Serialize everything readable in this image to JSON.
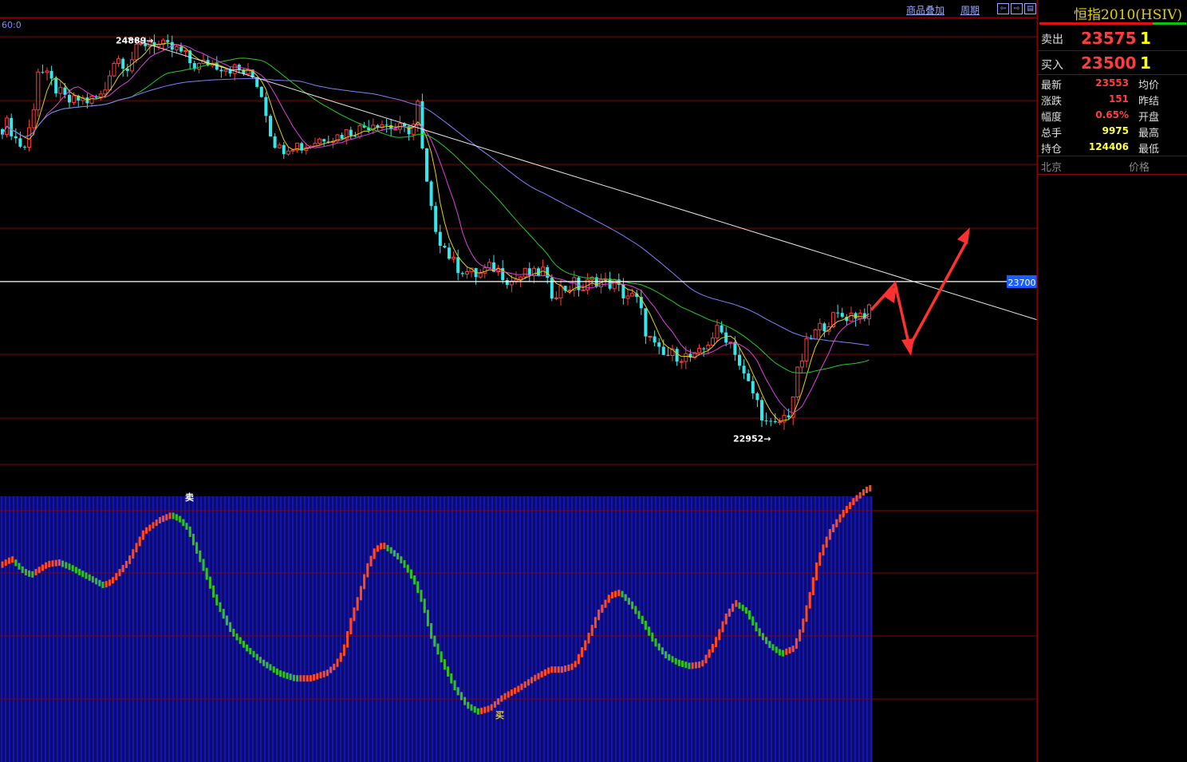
{
  "toolbar": {
    "overlay_label": "商品叠加",
    "period_label": "周期",
    "nav_left": "⇦",
    "nav_right": "⇨",
    "nav_menu": "▤",
    "period_indicator": "60:0"
  },
  "quote_panel": {
    "title": "恒指2010(HSIV)",
    "sell_label": "卖出",
    "sell_price": "23575",
    "sell_qty": "1",
    "buy_label": "买入",
    "buy_price": "23500",
    "buy_qty": "1",
    "rows": [
      {
        "label": "最新",
        "value": "23553",
        "label2": "均价",
        "color": "#ff4040"
      },
      {
        "label": "涨跌",
        "value": "151",
        "label2": "昨结",
        "color": "#ff4040"
      },
      {
        "label": "幅度",
        "value": "0.65%",
        "label2": "开盘",
        "color": "#ff4040"
      },
      {
        "label": "总手",
        "value": "9975",
        "label2": "最高",
        "color": "#ffff40"
      },
      {
        "label": "持仓",
        "value": "124406",
        "label2": "最低",
        "color": "#ffff40"
      }
    ],
    "footer_left": "北京",
    "footer_right": "价格"
  },
  "colors": {
    "up_candle": "#ff3c3c",
    "down_candle": "#33e8ea",
    "ma1": "#e6d200",
    "ma2": "#e040e0",
    "ma3": "#20d020",
    "ma4": "#8080ff",
    "grid": "#8b0000",
    "osc_bg": "#1a1ac8",
    "osc_up": "#ff4a20",
    "osc_down": "#30c020"
  },
  "chart_data": {
    "type": "candlestick",
    "ylim": [
      22800,
      25000
    ],
    "price_line": 23700,
    "price_line_label": "23700",
    "high_label": "24889",
    "low_label": "22952",
    "close_path": [
      [
        0,
        24450
      ],
      [
        10,
        24480
      ],
      [
        20,
        24400
      ],
      [
        30,
        24350
      ],
      [
        40,
        24500
      ],
      [
        48,
        24750
      ],
      [
        60,
        24700
      ],
      [
        70,
        24650
      ],
      [
        80,
        24600
      ],
      [
        90,
        24580
      ],
      [
        100,
        24600
      ],
      [
        110,
        24590
      ],
      [
        120,
        24600
      ],
      [
        130,
        24620
      ],
      [
        140,
        24780
      ],
      [
        150,
        24800
      ],
      [
        160,
        24760
      ],
      [
        170,
        24830
      ],
      [
        180,
        24870
      ],
      [
        190,
        24889
      ],
      [
        200,
        24860
      ],
      [
        210,
        24850
      ],
      [
        220,
        24840
      ],
      [
        230,
        24820
      ],
      [
        240,
        24770
      ],
      [
        250,
        24760
      ],
      [
        260,
        24780
      ],
      [
        270,
        24770
      ],
      [
        280,
        24760
      ],
      [
        290,
        24750
      ],
      [
        300,
        24740
      ],
      [
        310,
        24720
      ],
      [
        320,
        24700
      ],
      [
        330,
        24600
      ],
      [
        340,
        24420
      ],
      [
        350,
        24350
      ],
      [
        360,
        24370
      ],
      [
        370,
        24380
      ],
      [
        380,
        24360
      ],
      [
        390,
        24380
      ],
      [
        400,
        24400
      ],
      [
        410,
        24420
      ],
      [
        420,
        24410
      ],
      [
        430,
        24430
      ],
      [
        440,
        24440
      ],
      [
        450,
        24450
      ],
      [
        460,
        24470
      ],
      [
        470,
        24490
      ],
      [
        480,
        24480
      ],
      [
        490,
        24460
      ],
      [
        500,
        24450
      ],
      [
        510,
        24440
      ],
      [
        520,
        24480
      ],
      [
        525,
        24600
      ],
      [
        530,
        24300
      ],
      [
        540,
        24050
      ],
      [
        550,
        23920
      ],
      [
        560,
        23850
      ],
      [
        570,
        23780
      ],
      [
        580,
        23760
      ],
      [
        590,
        23740
      ],
      [
        600,
        23730
      ],
      [
        610,
        23760
      ],
      [
        620,
        23770
      ],
      [
        630,
        23740
      ],
      [
        640,
        23700
      ],
      [
        650,
        23720
      ],
      [
        660,
        23740
      ],
      [
        670,
        23730
      ],
      [
        680,
        23760
      ],
      [
        690,
        23640
      ],
      [
        700,
        23660
      ],
      [
        710,
        23670
      ],
      [
        720,
        23690
      ],
      [
        730,
        23660
      ],
      [
        740,
        23700
      ],
      [
        750,
        23710
      ],
      [
        760,
        23690
      ],
      [
        770,
        23690
      ],
      [
        780,
        23640
      ],
      [
        790,
        23630
      ],
      [
        800,
        23600
      ],
      [
        810,
        23450
      ],
      [
        820,
        23380
      ],
      [
        830,
        23330
      ],
      [
        840,
        23340
      ],
      [
        850,
        23340
      ],
      [
        860,
        23330
      ],
      [
        870,
        23320
      ],
      [
        880,
        23350
      ],
      [
        890,
        23420
      ],
      [
        900,
        23460
      ],
      [
        910,
        23430
      ],
      [
        920,
        23380
      ],
      [
        930,
        23250
      ],
      [
        940,
        23180
      ],
      [
        950,
        23100
      ],
      [
        960,
        23000
      ],
      [
        970,
        22980
      ],
      [
        980,
        23020
      ],
      [
        990,
        23060
      ],
      [
        1000,
        23250
      ],
      [
        1010,
        23380
      ],
      [
        1020,
        23440
      ],
      [
        1030,
        23480
      ],
      [
        1040,
        23510
      ],
      [
        1050,
        23530
      ],
      [
        1060,
        23530
      ],
      [
        1070,
        23540
      ],
      [
        1080,
        23540
      ],
      [
        1090,
        23553
      ]
    ],
    "indicator_path": [
      [
        0,
        0.33
      ],
      [
        15,
        0.37
      ],
      [
        30,
        0.3
      ],
      [
        40,
        0.28
      ],
      [
        60,
        0.34
      ],
      [
        75,
        0.35
      ],
      [
        90,
        0.32
      ],
      [
        110,
        0.27
      ],
      [
        130,
        0.22
      ],
      [
        140,
        0.24
      ],
      [
        160,
        0.35
      ],
      [
        180,
        0.52
      ],
      [
        200,
        0.59
      ],
      [
        215,
        0.62
      ],
      [
        225,
        0.6
      ],
      [
        235,
        0.55
      ],
      [
        250,
        0.38
      ],
      [
        270,
        0.14
      ],
      [
        290,
        -0.04
      ],
      [
        310,
        -0.14
      ],
      [
        330,
        -0.22
      ],
      [
        350,
        -0.28
      ],
      [
        370,
        -0.31
      ],
      [
        390,
        -0.31
      ],
      [
        410,
        -0.28
      ],
      [
        420,
        -0.24
      ],
      [
        430,
        -0.16
      ],
      [
        440,
        0.02
      ],
      [
        450,
        0.16
      ],
      [
        460,
        0.32
      ],
      [
        470,
        0.42
      ],
      [
        480,
        0.45
      ],
      [
        490,
        0.42
      ],
      [
        500,
        0.38
      ],
      [
        510,
        0.32
      ],
      [
        520,
        0.24
      ],
      [
        530,
        0.12
      ],
      [
        540,
        -0.06
      ],
      [
        555,
        -0.22
      ],
      [
        570,
        -0.36
      ],
      [
        585,
        -0.46
      ],
      [
        600,
        -0.5
      ],
      [
        615,
        -0.48
      ],
      [
        630,
        -0.42
      ],
      [
        650,
        -0.37
      ],
      [
        670,
        -0.31
      ],
      [
        690,
        -0.26
      ],
      [
        705,
        -0.26
      ],
      [
        720,
        -0.24
      ],
      [
        735,
        -0.1
      ],
      [
        750,
        0.06
      ],
      [
        765,
        0.16
      ],
      [
        778,
        0.18
      ],
      [
        790,
        0.12
      ],
      [
        805,
        0.02
      ],
      [
        820,
        -0.1
      ],
      [
        835,
        -0.18
      ],
      [
        850,
        -0.22
      ],
      [
        865,
        -0.24
      ],
      [
        880,
        -0.23
      ],
      [
        895,
        -0.12
      ],
      [
        910,
        0.04
      ],
      [
        922,
        0.12
      ],
      [
        935,
        0.08
      ],
      [
        950,
        -0.04
      ],
      [
        965,
        -0.12
      ],
      [
        980,
        -0.17
      ],
      [
        995,
        -0.14
      ],
      [
        1005,
        -0.02
      ],
      [
        1015,
        0.16
      ],
      [
        1025,
        0.36
      ],
      [
        1040,
        0.52
      ],
      [
        1055,
        0.62
      ],
      [
        1070,
        0.7
      ],
      [
        1085,
        0.76
      ],
      [
        1094,
        0.78
      ]
    ],
    "sell_signal_label": "卖",
    "buy_signal_label": "买"
  }
}
